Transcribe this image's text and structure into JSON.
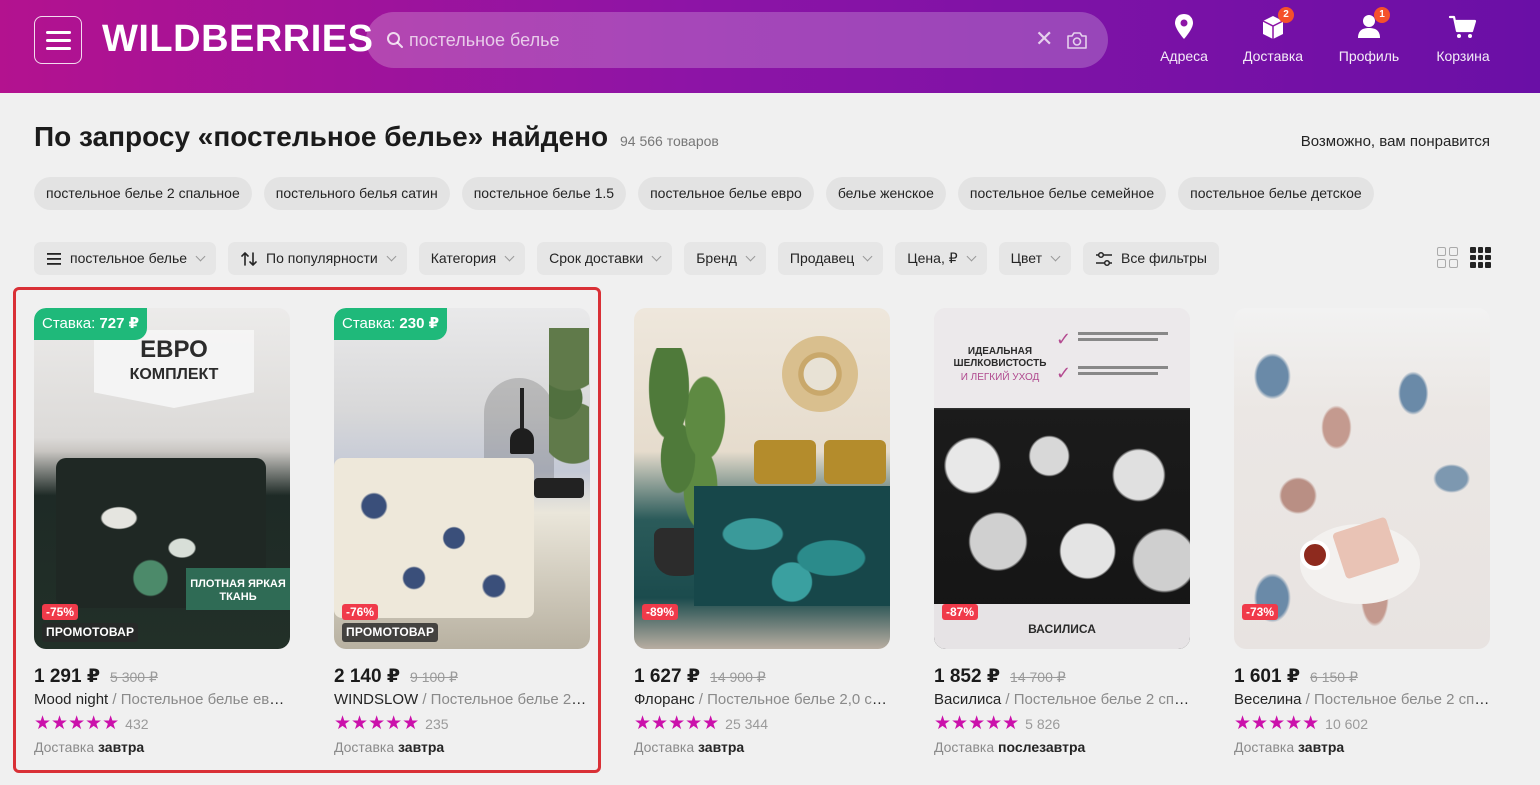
{
  "header": {
    "logo": "WILDBERRIES",
    "search_value": "постельное белье",
    "nav": [
      {
        "label": "Адреса",
        "icon": "location-pin-icon",
        "badge": ""
      },
      {
        "label": "Доставка",
        "icon": "box-icon",
        "badge": "2"
      },
      {
        "label": "Профиль",
        "icon": "user-icon",
        "badge": "1"
      },
      {
        "label": "Корзина",
        "icon": "cart-icon",
        "badge": ""
      }
    ],
    "accent": "#b3128f"
  },
  "results": {
    "title": "По запросу «постельное белье» найдено",
    "count": "94 566 товаров",
    "maybe": "Возможно, вам понравится"
  },
  "chips": [
    "постельное белье 2 спальное",
    "постельного белья сатин",
    "постельное белье 1.5",
    "постельное белье евро",
    "белье женское",
    "постельное белье семейное",
    "постельное белье детское"
  ],
  "filters": [
    "постельное белье",
    "По популярности",
    "Категория",
    "Срок доставки",
    "Бренд",
    "Продавец",
    "Цена, ₽",
    "Цвет",
    "Все фильтры"
  ],
  "products": [
    {
      "stake_label": "Ставка:",
      "stake_value": "727 ₽",
      "discount": "-75%",
      "promo": "ПРОМОТОВАР",
      "price": "1 291 ₽",
      "old_price": "5 300 ₽",
      "brand": "Mood night",
      "name": " / Постельное белье евро ...",
      "stars": "★★★★★",
      "reviews": "432",
      "ship_label": "Доставка ",
      "ship_day": "завтра",
      "image_text_1": "ЕВРО",
      "image_text_2": "КОМПЛЕКТ",
      "image_text_3": "ПЛОТНАЯ ЯРКАЯ",
      "image_text_4": "ТКАНЬ"
    },
    {
      "stake_label": "Ставка:",
      "stake_value": "230 ₽",
      "discount": "-76%",
      "promo": "ПРОМОТОВАР",
      "price": "2 140 ₽",
      "old_price": "9 100 ₽",
      "brand": "WINDSLOW",
      "name": " / Постельное белье 2 спа...",
      "stars": "★★★★★",
      "reviews": "235",
      "ship_label": "Доставка ",
      "ship_day": "завтра"
    },
    {
      "discount": "-89%",
      "price": "1 627 ₽",
      "old_price": "14 900 ₽",
      "brand": "Флоранс",
      "name": " / Постельное белье 2,0 спал...",
      "stars": "★★★★★",
      "reviews": "25 344",
      "ship_label": "Доставка ",
      "ship_day": "завтра"
    },
    {
      "discount": "-87%",
      "price": "1 852 ₽",
      "old_price": "14 700 ₽",
      "brand": "Василиса",
      "name": " / Постельное белье 2 спаль...",
      "stars": "★★★★★",
      "reviews": "5 826",
      "ship_label": "Доставка ",
      "ship_day": "послезавтра",
      "image_text_1": "ИДЕАЛЬНАЯ ШЕЛКОВИСТОСТЬ",
      "image_text_2": "И ЛЕГКИЙ УХОД",
      "image_text_3": "ВАСИЛИСА"
    },
    {
      "discount": "-73%",
      "price": "1 601 ₽",
      "old_price": "6 150 ₽",
      "brand": "Веселина",
      "name": " / Постельное белье 2 спаль...",
      "stars": "★★★★★",
      "reviews": "10 602",
      "ship_label": "Доставка ",
      "ship_day": "завтра"
    }
  ]
}
